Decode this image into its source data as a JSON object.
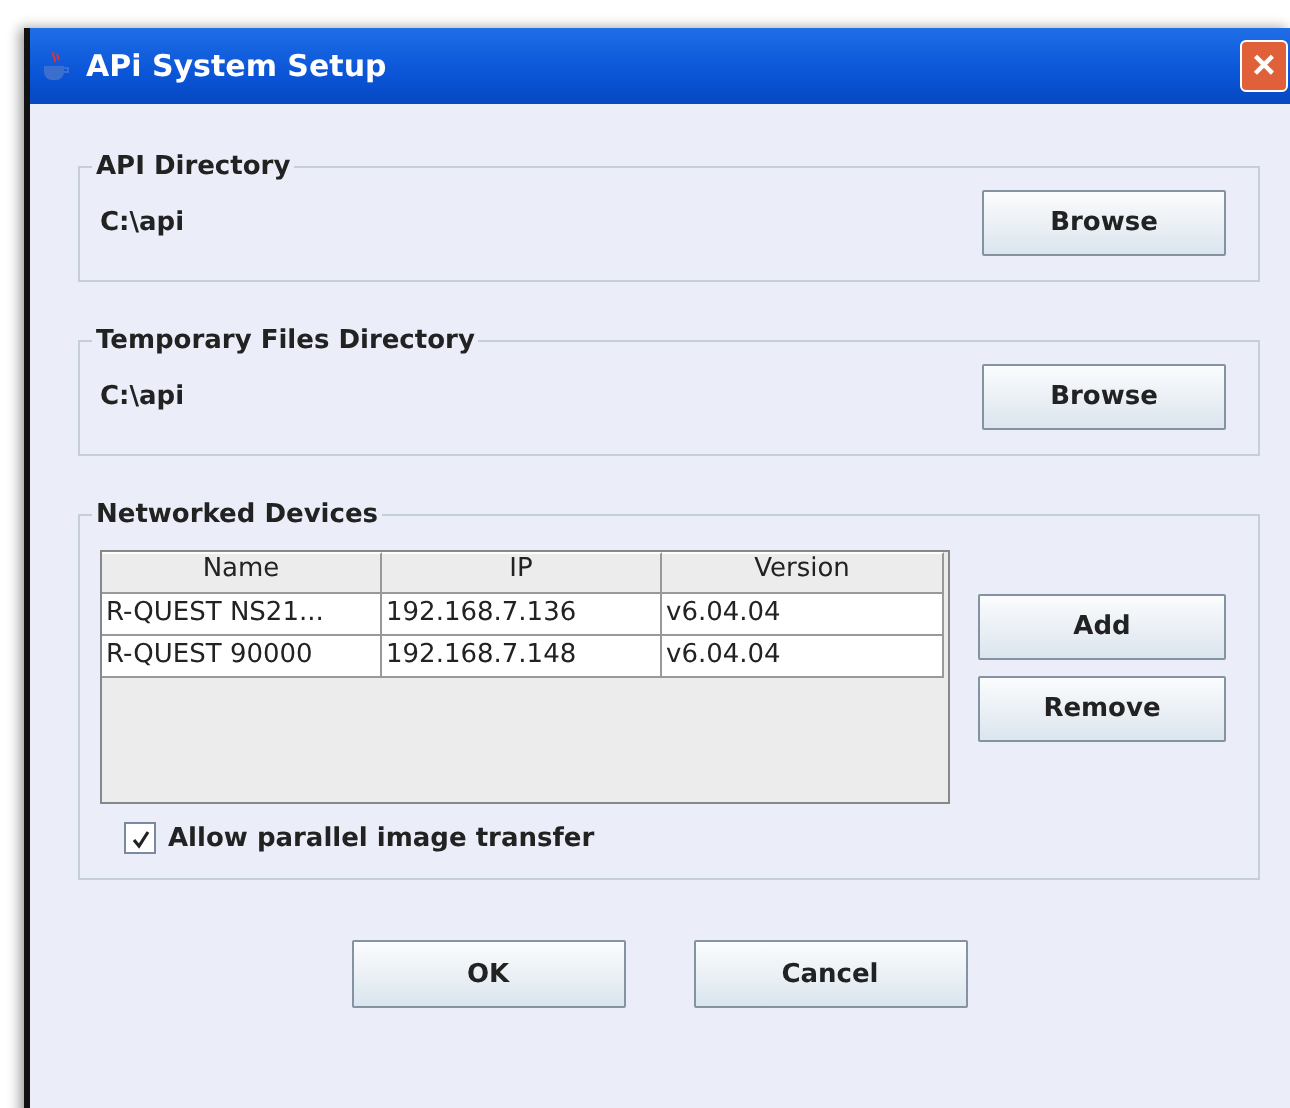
{
  "window": {
    "title": "APi System Setup",
    "close": "×"
  },
  "directories": [
    {
      "title": "API Directory",
      "path": "C:\\api",
      "button": "Browse"
    },
    {
      "title": "Temporary Files Directory",
      "path": "C:\\api",
      "button": "Browse"
    }
  ],
  "devices": {
    "title": "Networked Devices",
    "columns": [
      "Name",
      "IP",
      "Version"
    ],
    "rows": [
      [
        "R-QUEST NS21...",
        "192.168.7.136",
        "v6.04.04"
      ],
      [
        "R-QUEST 90000",
        "192.168.7.148",
        "v6.04.04"
      ]
    ],
    "buttons": [
      "Add",
      "Remove"
    ],
    "parallel": {
      "label": "Allow parallel image transfer",
      "checked": true
    }
  },
  "buttons": [
    "OK",
    "Cancel"
  ]
}
